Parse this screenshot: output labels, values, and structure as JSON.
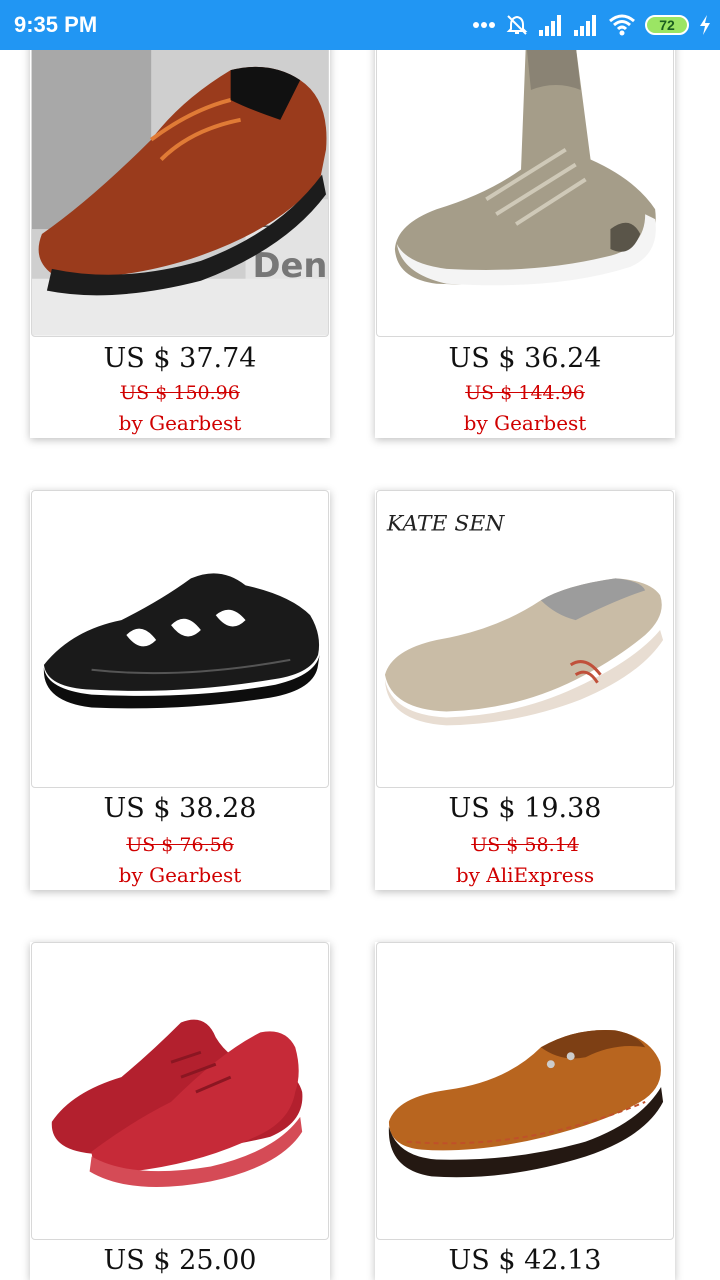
{
  "status_bar": {
    "time": "9:35 PM",
    "battery": "72",
    "icons": [
      "more-dots-icon",
      "alarm-off-icon",
      "signal-icon",
      "signal-icon",
      "wifi-icon",
      "battery-icon",
      "charging-icon"
    ]
  },
  "products": [
    {
      "price": "US $ 37.74",
      "old_price": "US $ 150.96",
      "seller": "by Gearbest",
      "image": "brown-leather-sneaker"
    },
    {
      "price": "US $ 36.24",
      "old_price": "US $ 144.96",
      "seller": "by Gearbest",
      "image": "knit-high-top-sneaker"
    },
    {
      "price": "US $ 38.28",
      "old_price": "US $ 76.56",
      "seller": "by Gearbest",
      "image": "black-leather-sandal"
    },
    {
      "price": "US $ 19.38",
      "old_price": "US $ 58.14",
      "seller": "by AliExpress",
      "image": "beige-suede-loafer",
      "brand_mark": "KATE SEN"
    },
    {
      "price": "US $ 25.00",
      "image": "red-knit-sneaker"
    },
    {
      "price": "US $ 42.13",
      "image": "brown-leather-moccasin"
    }
  ]
}
